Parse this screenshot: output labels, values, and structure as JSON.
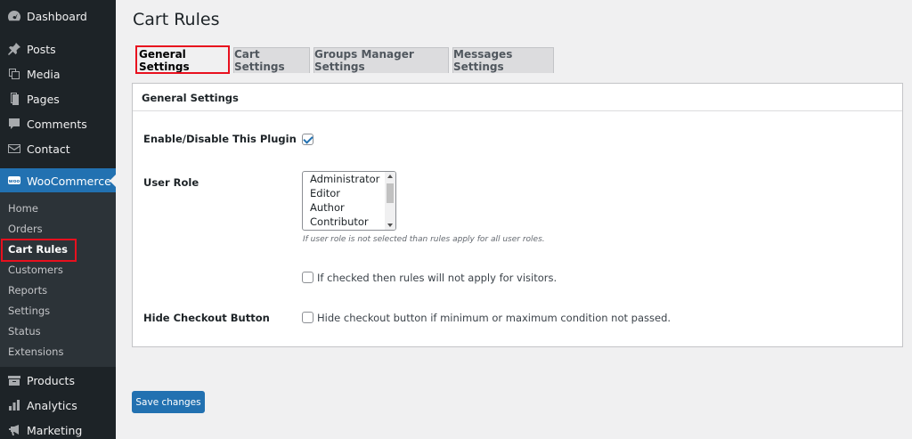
{
  "sidebar": {
    "top_items": [
      {
        "label": "Dashboard",
        "icon": "dashboard-icon"
      },
      {
        "label": "Posts",
        "icon": "pin-icon"
      },
      {
        "label": "Media",
        "icon": "media-icon"
      },
      {
        "label": "Pages",
        "icon": "pages-icon"
      },
      {
        "label": "Comments",
        "icon": "comment-icon"
      },
      {
        "label": "Contact",
        "icon": "mail-icon"
      }
    ],
    "woocommerce": {
      "label": "WooCommerce",
      "icon": "woo-icon",
      "icon_text": "woo"
    },
    "submenu": [
      "Home",
      "Orders",
      "Cart Rules",
      "Customers",
      "Reports",
      "Settings",
      "Status",
      "Extensions"
    ],
    "bottom_items": [
      {
        "label": "Products",
        "icon": "products-icon"
      },
      {
        "label": "Analytics",
        "icon": "analytics-icon"
      },
      {
        "label": "Marketing",
        "icon": "megaphone-icon"
      }
    ]
  },
  "main": {
    "title": "Cart Rules",
    "tabs": [
      "General Settings",
      "Cart Settings",
      "Groups Manager Settings",
      "Messages Settings"
    ],
    "panel": {
      "header": "General Settings",
      "enable_label": "Enable/Disable This Plugin",
      "enable_checked": true,
      "user_role_label": "User Role",
      "user_role_options": [
        "Administrator",
        "Editor",
        "Author",
        "Contributor"
      ],
      "user_role_hint": "If user role is not selected than rules apply for all user roles.",
      "visitors_text": "If checked then rules will not apply for visitors.",
      "hide_checkout_label": "Hide Checkout Button",
      "hide_checkout_text": "Hide checkout button if minimum or maximum condition not passed."
    },
    "save_label": "Save changes"
  },
  "colors": {
    "sidebar_bg": "#1d2327",
    "accent": "#2271b1",
    "highlight": "#e8101e"
  }
}
